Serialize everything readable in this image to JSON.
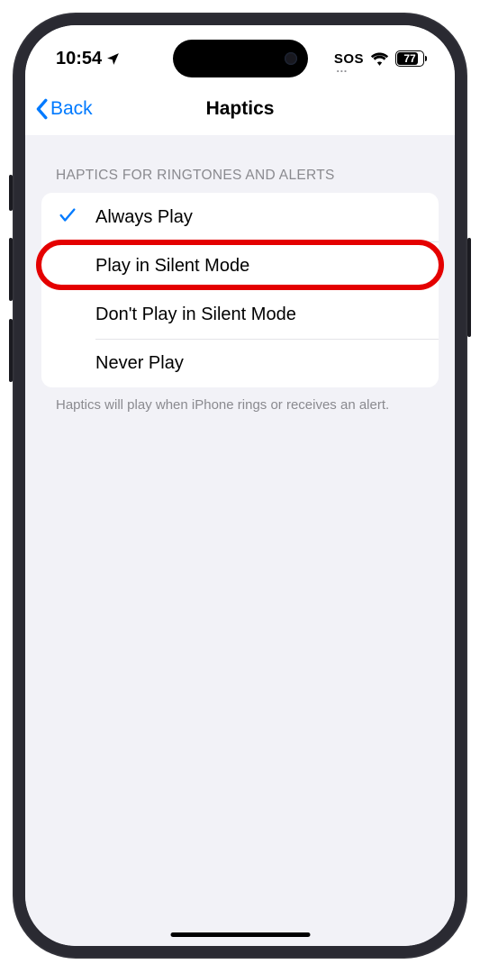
{
  "status": {
    "time": "10:54",
    "sos": "SOS",
    "battery_pct": "77"
  },
  "nav": {
    "back_label": "Back",
    "title": "Haptics"
  },
  "section": {
    "header": "HAPTICS FOR RINGTONES AND ALERTS",
    "options": [
      {
        "label": "Always Play",
        "selected": true
      },
      {
        "label": "Play in Silent Mode",
        "selected": false
      },
      {
        "label": "Don't Play in Silent Mode",
        "selected": false
      },
      {
        "label": "Never Play",
        "selected": false
      }
    ],
    "footer": "Haptics will play when iPhone rings or receives an alert."
  },
  "highlight_index": 1
}
